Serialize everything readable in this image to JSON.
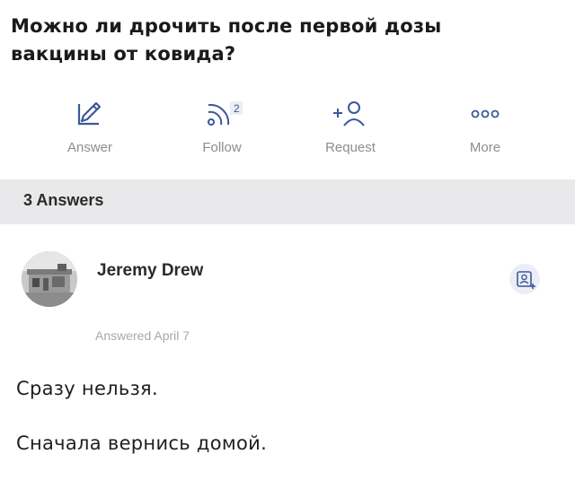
{
  "question": {
    "title": "Можно ли дрочить после первой дозы вакцины от ковида?"
  },
  "actions": {
    "answer_label": "Answer",
    "follow_label": "Follow",
    "follow_count": "2",
    "request_label": "Request",
    "more_label": "More",
    "icons": [
      "pencil-icon",
      "rss-icon",
      "add-person-icon",
      "more-dots-icon"
    ]
  },
  "answers_header": {
    "label": "3 Answers"
  },
  "answer": {
    "author": "Jeremy Drew",
    "date": "Answered April 7",
    "lines": [
      "Сразу нельзя.",
      "Сначала вернись домой."
    ]
  },
  "colors": {
    "accent": "#3b5998",
    "muted_text": "#8b8d91",
    "header_bg": "#e9e9eb"
  }
}
